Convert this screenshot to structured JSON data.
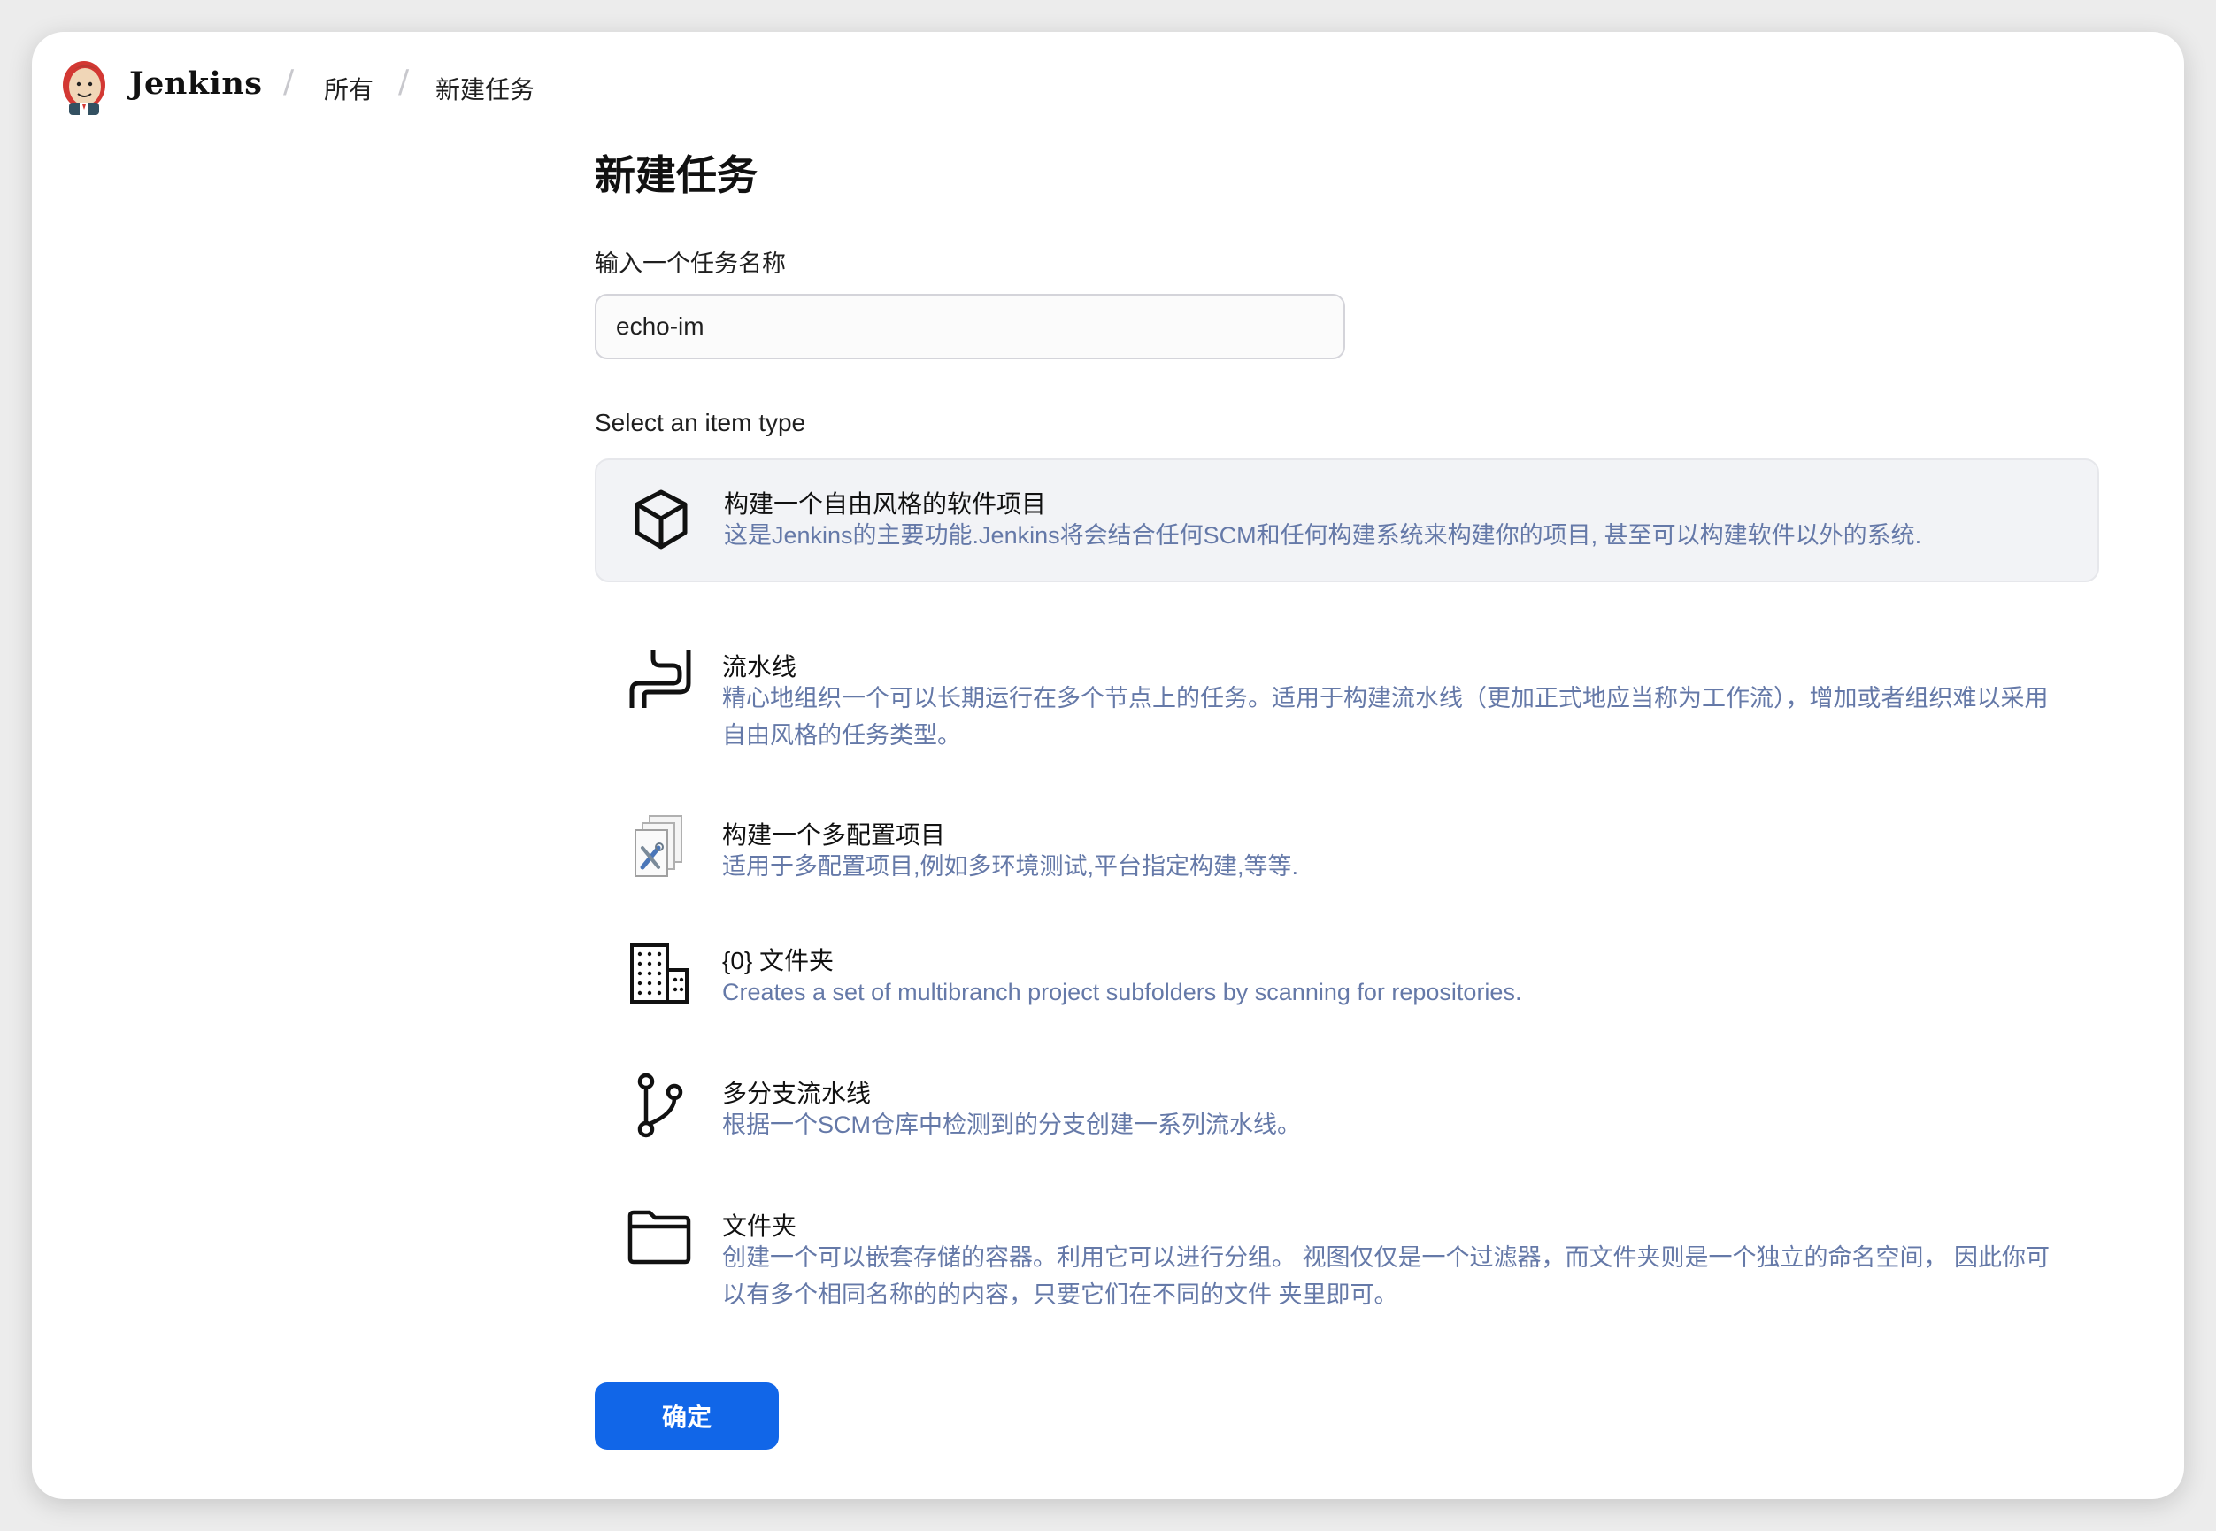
{
  "header": {
    "brand": "Jenkins",
    "breadcrumbs": [
      "所有",
      "新建任务"
    ],
    "separator": "/"
  },
  "main": {
    "title": "新建任务",
    "name_label": "输入一个任务名称",
    "name_value": "echo-im",
    "type_label": "Select an item type",
    "items": [
      {
        "icon": "cube-icon",
        "title": "构建一个自由风格的软件项目",
        "description": "这是Jenkins的主要功能.Jenkins将会结合任何SCM和任何构建系统来构建你的项目, 甚至可以构建软件以外的系统.",
        "selected": true
      },
      {
        "icon": "pipeline-icon",
        "title": "流水线",
        "description": "精心地组织一个可以长期运行在多个节点上的任务。适用于构建流水线（更加正式地应当称为工作流），增加或者组织难以采用自由风格的任务类型。",
        "selected": false
      },
      {
        "icon": "multi-configuration-icon",
        "title": "构建一个多配置项目",
        "description": "适用于多配置项目,例如多环境测试,平台指定构建,等等.",
        "selected": false
      },
      {
        "icon": "organization-folder-icon",
        "title": "{0} 文件夹",
        "description": "Creates a set of multibranch project subfolders by scanning for repositories.",
        "selected": false
      },
      {
        "icon": "branch-icon",
        "title": "多分支流水线",
        "description": "根据一个SCM仓库中检测到的分支创建一系列流水线。",
        "selected": false
      },
      {
        "icon": "folder-icon",
        "title": "文件夹",
        "description": "创建一个可以嵌套存储的容器。利用它可以进行分组。 视图仅仅是一个过滤器，而文件夹则是一个独立的命名空间， 因此你可以有多个相同名称的的内容，只要它们在不同的文件 夹里即可。",
        "selected": false
      }
    ],
    "ok_button": "确定"
  },
  "colors": {
    "accent": "#1166e8",
    "description": "#6579a8",
    "selected_bg": "#f2f3f6"
  }
}
